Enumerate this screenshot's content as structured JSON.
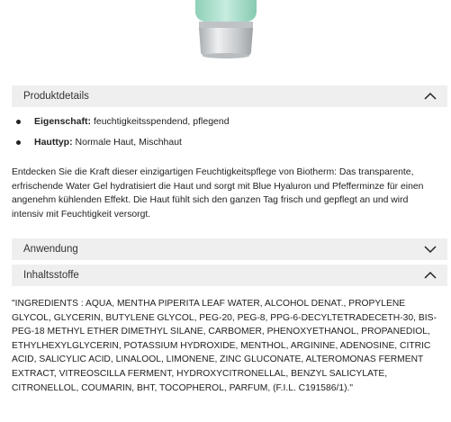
{
  "product_image": {
    "alt_semantic": "product-tube-cap"
  },
  "sections": {
    "details": {
      "title": "Produktdetails",
      "expanded": true,
      "bullets": [
        {
          "key": "Eigenschaft:",
          "value": "feuchtigkeitsspendend, pflegend"
        },
        {
          "key": "Hauttyp:",
          "value": "Normale Haut, Mischhaut"
        }
      ],
      "description": "Entdecken Sie die Kraft dieser einzigartigen Feuchtigkeitspflege von Biotherm: Das transparente, erfrischende Water Gel hydratisiert die Haut und sorgt mit Blue Hyaluron und Pfefferminze für einen angenehm kühlenden Effekt. Die Haut fühlt sich den ganzen Tag frisch und gepflegt an und wird intensiv mit Feuchtigkeit versorgt."
    },
    "usage": {
      "title": "Anwendung",
      "expanded": false
    },
    "ingredients": {
      "title": "Inhaltsstoffe",
      "expanded": true,
      "text": "\"INGREDIENTS : AQUA, MENTHA PIPERITA LEAF WATER, ALCOHOL DENAT., PROPYLENE GLYCOL, GLYCERIN, BUTYLENE GLYCOL, PEG-20, PEG-8, PPG-6-DECYLTETRADECETH-30, BIS-PEG-18 METHYL ETHER DIMETHYL SILANE, CARBOMER, PHENOXYETHANOL, PROPANEDIOL, ETHYLHEXYLGLYCERIN, POTASSIUM HYDROXIDE, MENTHOL, ARGININE, ADENOSINE, CITRIC ACID, SALICYLIC ACID, LINALOOL, LIMONENE, ZINC GLUCONATE, ALTEROMONAS FERMENT EXTRACT, VITREOSCILLA FERMENT, HYDROXYCITRONELLAL, BENZYL SALICYLATE, CITRONELLOL, COUMARIN, BHT, TOCOPHEROL, PARFUM, (F.I.L. C191586/1).\""
    }
  },
  "icons": {
    "collapse": "chevron-up-icon",
    "expand": "chevron-down-icon",
    "bullet": "bullet-dot-icon"
  },
  "colors": {
    "header_bg": "#efefef",
    "tube_green": "#a8d8c4",
    "cap_gray": "#c9ccce"
  }
}
